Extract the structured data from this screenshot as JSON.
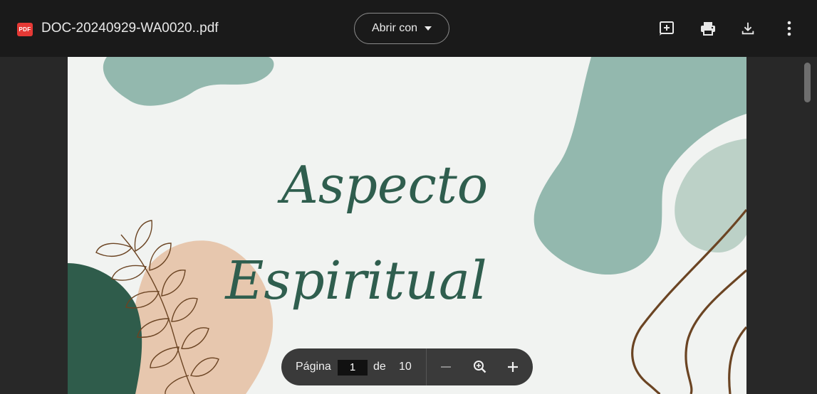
{
  "toolbar": {
    "file_badge": "PDF",
    "file_name": "DOC-20240929-WA0020..pdf",
    "open_with_label": "Abrir con",
    "icons": [
      "add-annotation-icon",
      "print-icon",
      "download-icon",
      "more-vert-icon"
    ]
  },
  "document": {
    "title_line1": "Aspecto",
    "title_line2": "Espiritual"
  },
  "pager": {
    "page_label": "Página",
    "current_page": "1",
    "of_label": "de",
    "total_pages": "10"
  },
  "colors": {
    "toolbar_bg": "#1a1a1a",
    "viewer_bg": "#282828",
    "page_bg": "#f1f3f1",
    "teal": "#93b8ae",
    "pale_teal": "#bcd1c7",
    "dark_green": "#2f5c4b",
    "peach": "#e7c7ae",
    "brown": "#6b4423",
    "title_green": "#2f5e4e"
  }
}
